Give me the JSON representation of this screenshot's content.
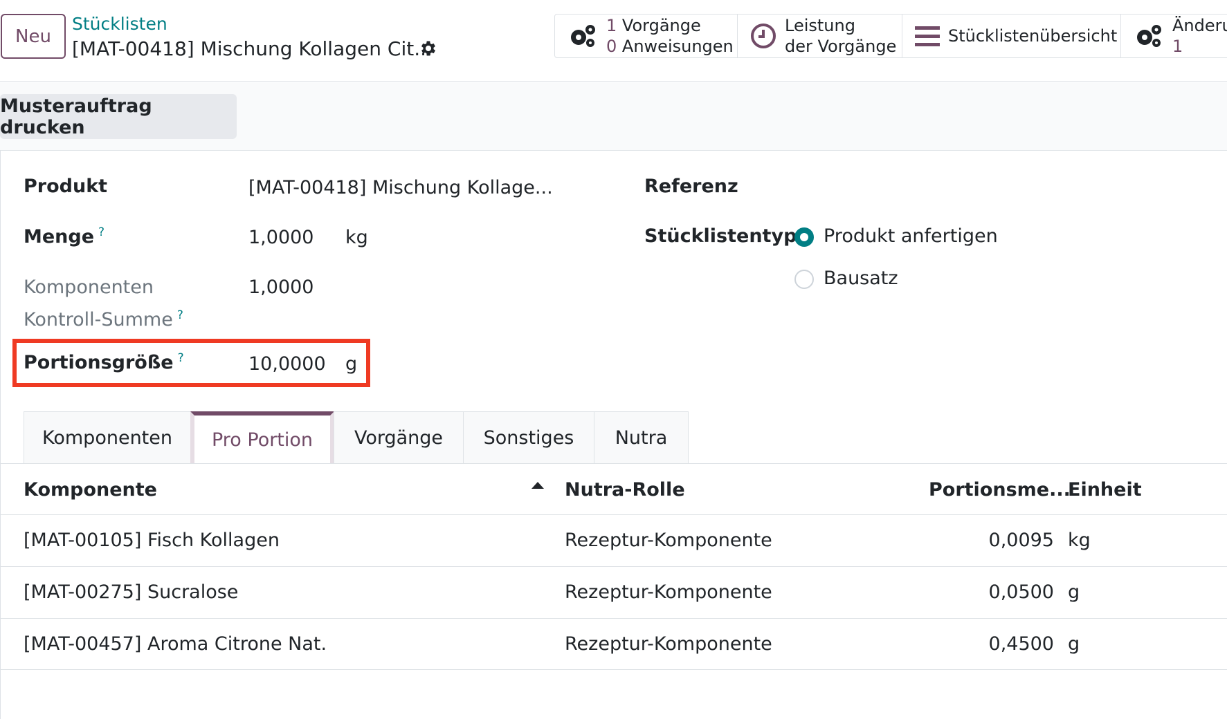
{
  "header": {
    "new_button": "Neu",
    "breadcrumb": "Stücklisten",
    "record_title": "[MAT-00418] Mischung Kollagen Cit...",
    "smart_buttons": [
      {
        "icon": "gears-icon",
        "line1_num": "1",
        "line1_text": "Vorgänge",
        "line2_num": "0",
        "line2_text": "Anweisungen"
      },
      {
        "icon": "clock-icon",
        "line1_text": "Leistung",
        "line2_text": "der Vorgänge"
      },
      {
        "icon": "bars-icon",
        "label": "Stücklistenübersicht"
      },
      {
        "icon": "gears-icon",
        "line1_text": "Änderun",
        "line2_num": "1"
      }
    ]
  },
  "statusbar": {
    "print_button": "Musterauftrag drucken"
  },
  "form": {
    "product_label": "Produkt",
    "product_value": "[MAT-00418] Mischung Kollage...",
    "quantity_label": "Menge",
    "quantity_help": "?",
    "quantity_value": "1,0000",
    "quantity_uom": "kg",
    "checksum_label_1": "Komponenten",
    "checksum_label_2": "Kontroll-Summe",
    "checksum_help": "?",
    "checksum_value": "1,0000",
    "portion_label": "Portionsgröße",
    "portion_help": "?",
    "portion_value": "10,0000",
    "portion_uom": "g",
    "reference_label": "Referenz",
    "bom_type_label": "Stücklistentyp",
    "bom_type_options": [
      {
        "label": "Produkt anfertigen",
        "selected": true
      },
      {
        "label": "Bausatz",
        "selected": false
      }
    ]
  },
  "tabs": [
    {
      "label": "Komponenten",
      "active": false
    },
    {
      "label": "Pro Portion",
      "active": true
    },
    {
      "label": "Vorgänge",
      "active": false
    },
    {
      "label": "Sonstiges",
      "active": false
    },
    {
      "label": "Nutra",
      "active": false
    }
  ],
  "table": {
    "columns": [
      "Komponente",
      "Nutra-Rolle",
      "Portionsme...",
      "Einheit"
    ],
    "rows": [
      {
        "component": "[MAT-00105] Fisch Kollagen",
        "role": "Rezeptur-Komponente",
        "qty": "0,0095",
        "uom": "kg"
      },
      {
        "component": "[MAT-00275] Sucralose",
        "role": "Rezeptur-Komponente",
        "qty": "0,0500",
        "uom": "g"
      },
      {
        "component": "[MAT-00457] Aroma Citrone Nat.",
        "role": "Rezeptur-Komponente",
        "qty": "0,4500",
        "uom": "g"
      }
    ]
  },
  "colors": {
    "brand": "#714B67",
    "teal": "#017e84",
    "highlight": "#ef3a23"
  }
}
